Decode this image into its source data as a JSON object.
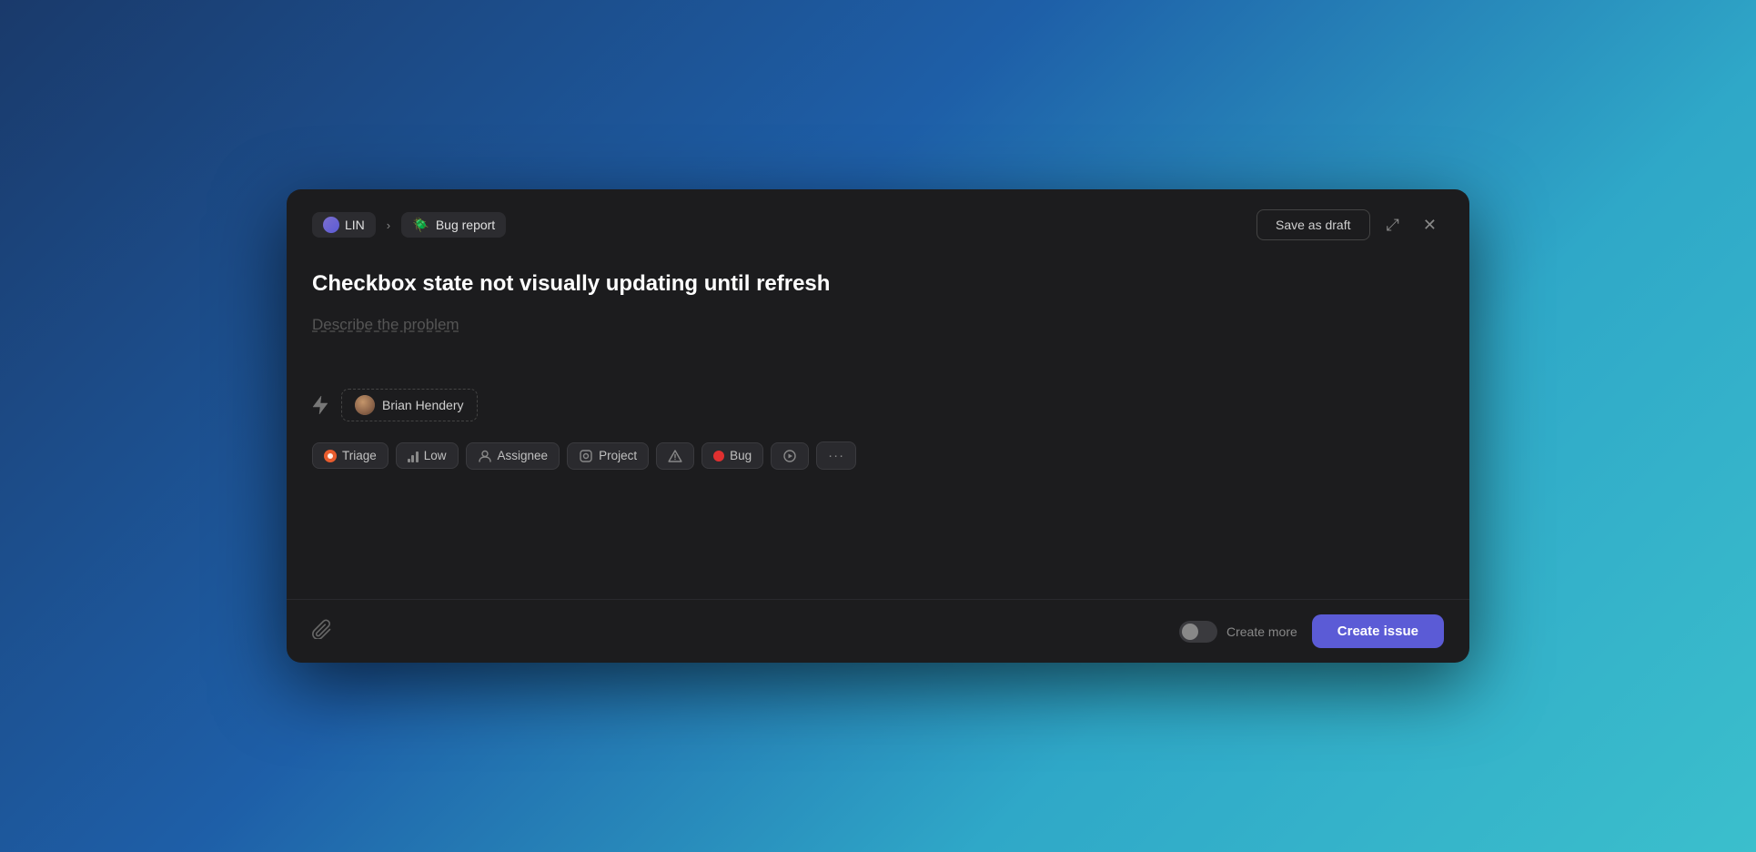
{
  "modal": {
    "lin_label": "LIN",
    "chevron": "›",
    "template_emoji": "🪲",
    "template_label": "Bug report",
    "save_draft_label": "Save as draft",
    "expand_icon": "⤢",
    "close_icon": "✕",
    "issue_title": "Checkbox state not visually updating until refresh",
    "description_placeholder": "Describe the problem",
    "assignee_name": "Brian Hendery",
    "tags": [
      {
        "id": "triage",
        "label": "Triage",
        "type": "triage"
      },
      {
        "id": "low",
        "label": "Low",
        "type": "priority"
      },
      {
        "id": "assignee",
        "label": "Assignee",
        "type": "assignee"
      },
      {
        "id": "project",
        "label": "Project",
        "type": "project"
      },
      {
        "id": "warning",
        "label": "",
        "type": "warning"
      },
      {
        "id": "bug",
        "label": "Bug",
        "type": "bug"
      },
      {
        "id": "play",
        "label": "",
        "type": "play"
      },
      {
        "id": "more",
        "label": "···",
        "type": "more"
      }
    ],
    "attach_icon": "📎",
    "create_more_label": "Create more",
    "create_issue_label": "Create issue"
  }
}
